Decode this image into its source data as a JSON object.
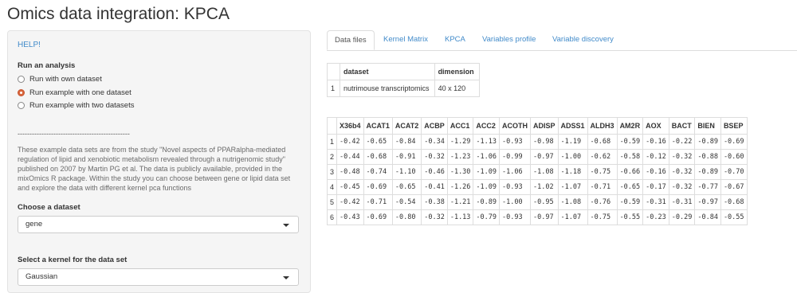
{
  "app": {
    "title": "Omics data integration: KPCA"
  },
  "sidebar": {
    "help_link": "HELP!",
    "run_label": "Run an analysis",
    "options": [
      {
        "label": "Run with own dataset",
        "checked": false
      },
      {
        "label": "Run example with one dataset",
        "checked": true
      },
      {
        "label": "Run example with two datasets",
        "checked": false
      }
    ],
    "separator": "-----------------------------------------------",
    "description": "These example data sets are from the study \"Novel aspects of PPARalpha-mediated regulation of lipid and xenobiotic metabolism revealed through a nutrigenomic study\" published on 2007 by Martin PG et al. The data is publicly available, provided in the mixOmics R package. Within the study you can choose between gene or lipid data set and explore the data with different kernel pca functions",
    "dataset_label": "Choose a dataset",
    "dataset_value": "gene",
    "kernel_label": "Select a kernel for the data set",
    "kernel_value": "Gaussian"
  },
  "tabs": [
    "Data files",
    "Kernel Matrix",
    "KPCA",
    "Variables profile",
    "Variable discovery"
  ],
  "summary_table": {
    "headers": [
      "",
      "dataset",
      "dimension"
    ],
    "rows": [
      [
        "1",
        "nutrimouse transcriptomics",
        "40 x 120"
      ]
    ]
  },
  "data_table": {
    "headers": [
      "",
      "X36b4",
      "ACAT1",
      "ACAT2",
      "ACBP",
      "ACC1",
      "ACC2",
      "ACOTH",
      "ADISP",
      "ADSS1",
      "ALDH3",
      "AM2R",
      "AOX",
      "BACT",
      "BIEN",
      "BSEP"
    ],
    "rows": [
      [
        "1",
        "-0.42",
        "-0.65",
        "-0.84",
        "-0.34",
        "-1.29",
        "-1.13",
        "-0.93",
        "-0.98",
        "-1.19",
        "-0.68",
        "-0.59",
        "-0.16",
        "-0.22",
        "-0.89",
        "-0.69"
      ],
      [
        "2",
        "-0.44",
        "-0.68",
        "-0.91",
        "-0.32",
        "-1.23",
        "-1.06",
        "-0.99",
        "-0.97",
        "-1.00",
        "-0.62",
        "-0.58",
        "-0.12",
        "-0.32",
        "-0.88",
        "-0.60"
      ],
      [
        "3",
        "-0.48",
        "-0.74",
        "-1.10",
        "-0.46",
        "-1.30",
        "-1.09",
        "-1.06",
        "-1.08",
        "-1.18",
        "-0.75",
        "-0.66",
        "-0.16",
        "-0.32",
        "-0.89",
        "-0.70"
      ],
      [
        "4",
        "-0.45",
        "-0.69",
        "-0.65",
        "-0.41",
        "-1.26",
        "-1.09",
        "-0.93",
        "-1.02",
        "-1.07",
        "-0.71",
        "-0.65",
        "-0.17",
        "-0.32",
        "-0.77",
        "-0.67"
      ],
      [
        "5",
        "-0.42",
        "-0.71",
        "-0.54",
        "-0.38",
        "-1.21",
        "-0.89",
        "-1.00",
        "-0.95",
        "-1.08",
        "-0.76",
        "-0.59",
        "-0.31",
        "-0.31",
        "-0.97",
        "-0.68"
      ],
      [
        "6",
        "-0.43",
        "-0.69",
        "-0.80",
        "-0.32",
        "-1.13",
        "-0.79",
        "-0.93",
        "-0.97",
        "-1.07",
        "-0.75",
        "-0.55",
        "-0.23",
        "-0.29",
        "-0.84",
        "-0.55"
      ]
    ]
  }
}
